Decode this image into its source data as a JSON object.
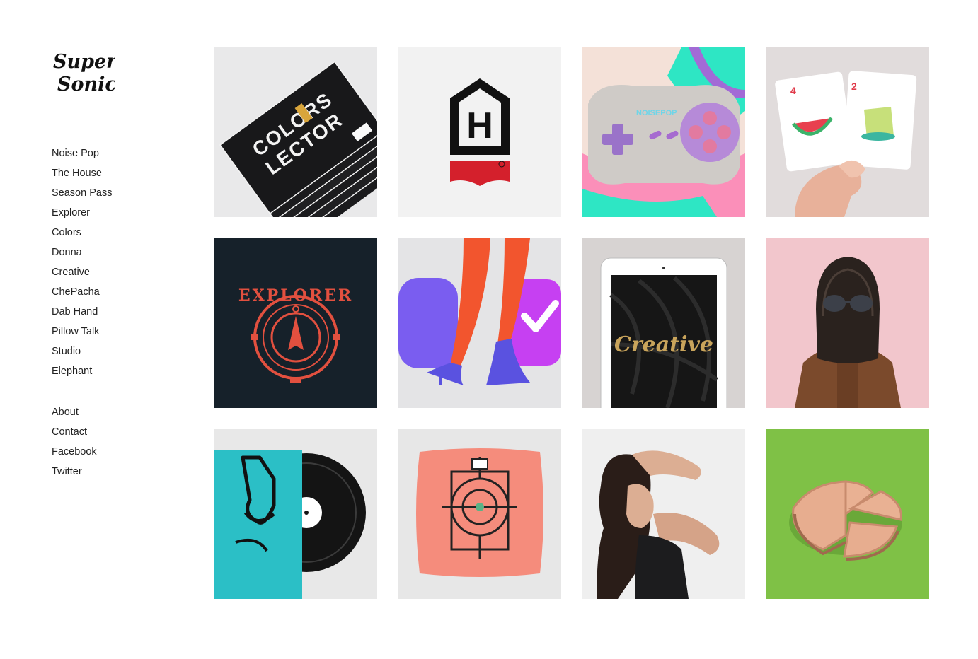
{
  "brand": {
    "logo_text": "Super Sonic",
    "logo_line1": "Super",
    "logo_line2": "Sonic"
  },
  "nav": {
    "projects": [
      {
        "label": "Noise Pop"
      },
      {
        "label": "The House"
      },
      {
        "label": "Season Pass"
      },
      {
        "label": "Explorer"
      },
      {
        "label": "Colors"
      },
      {
        "label": "Donna"
      },
      {
        "label": "Creative"
      },
      {
        "label": "ChePacha"
      },
      {
        "label": "Dab Hand"
      },
      {
        "label": "Pillow Talk"
      },
      {
        "label": "Studio"
      },
      {
        "label": "Elephant"
      }
    ],
    "pages": [
      {
        "label": "About"
      },
      {
        "label": "Contact"
      },
      {
        "label": "Facebook"
      },
      {
        "label": "Twitter"
      }
    ]
  },
  "grid": {
    "tiles": [
      {
        "image": "colors-magazine-stack",
        "text1": "COLORS",
        "text2": "LECTOR"
      },
      {
        "image": "the-house-logo",
        "text1": "H"
      },
      {
        "image": "noisepop-gamepad",
        "text1": "NOISEPOP"
      },
      {
        "image": "playing-cards-hand",
        "text1": "4",
        "text2": "2"
      },
      {
        "image": "explorer-compass-badge",
        "text1": "EXPLORER"
      },
      {
        "image": "legs-heels-purple-shapes"
      },
      {
        "image": "creative-tablet",
        "text1": "Creative"
      },
      {
        "image": "woman-hair-sunglasses"
      },
      {
        "image": "vinyl-record-teal-sleeve"
      },
      {
        "image": "coral-pillow-pattern"
      },
      {
        "image": "woman-portrait"
      },
      {
        "image": "wooden-pie-chart-green"
      }
    ]
  }
}
